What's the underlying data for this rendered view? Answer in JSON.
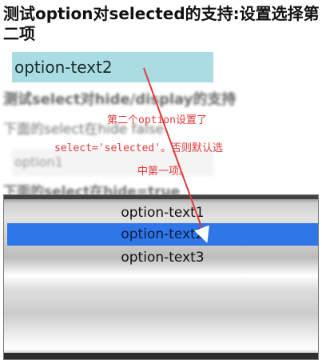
{
  "page": {
    "title": "测试option对selected的支持:设置选择第二项",
    "selected_text": "option-text2",
    "background_heading": "测试select对hide/display的支持",
    "background_para1": "下面的select在hide false",
    "background_select_value": "option1",
    "background_para2": "下面的select在hide=true"
  },
  "annotation": {
    "line1": "第二个option设置了",
    "line2": "select='selected'。否则默认选",
    "line3": "中第一项。",
    "color": "#e03a3a"
  },
  "dropdown": {
    "options": [
      "option-text1",
      "option-text2",
      "option-text3"
    ],
    "selected_index": 1,
    "highlight_color": "#2f76e8"
  }
}
